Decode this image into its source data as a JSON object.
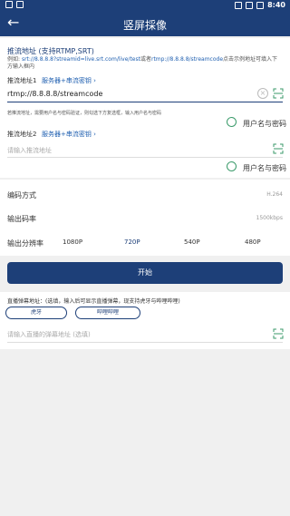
{
  "status_bar": {
    "time": "8:40"
  },
  "appbar": {
    "back": "←",
    "title": "竖屏採像"
  },
  "push": {
    "title": "推流地址 (支持RTMP,SRT)",
    "example_prefix": "例如:",
    "example_srt": "srt://8.8.8.8?streamid=live.srt.com/live/test",
    "example_or": "或者",
    "example_rtmp": "rtmp://8.8.8.8/streamcode",
    "example_suffix": "点击示例地址可填入下方输入框内",
    "url1": {
      "label": "推流地址1",
      "server_link": "服务器+串流密钥",
      "value": "rtmp://8.8.8.8/streamcode",
      "hint": "若推流地址，需要用户名与密码验证，则勾选下方复选框，输入用户名与密码",
      "auth_label": "用户名与密码"
    },
    "url2": {
      "label": "推流地址2",
      "server_link": "服务器+串流密钥",
      "placeholder": "请输入推流地址",
      "auth_label": "用户名与密码"
    }
  },
  "settings": {
    "encoding": {
      "label": "编码方式",
      "value": "H.264"
    },
    "bitrate": {
      "label": "输出码率",
      "value": "1500kbps"
    },
    "resolution": {
      "label": "输出分辨率",
      "options": [
        "1080P",
        "720P",
        "540P",
        "480P"
      ],
      "selected": "720P"
    }
  },
  "start_button": "开始",
  "live_comment": {
    "label": "直播弹幕地址：(选填，输入后可显示直播弹幕，现支持虎牙与哔哩哔哩)",
    "chips": [
      "虎牙",
      "哔哩哔哩"
    ],
    "placeholder": "请输入直播的弹幕地址 (选填)"
  },
  "colors": {
    "primary": "#1d3f78",
    "accent_green": "#3a9a6a"
  }
}
